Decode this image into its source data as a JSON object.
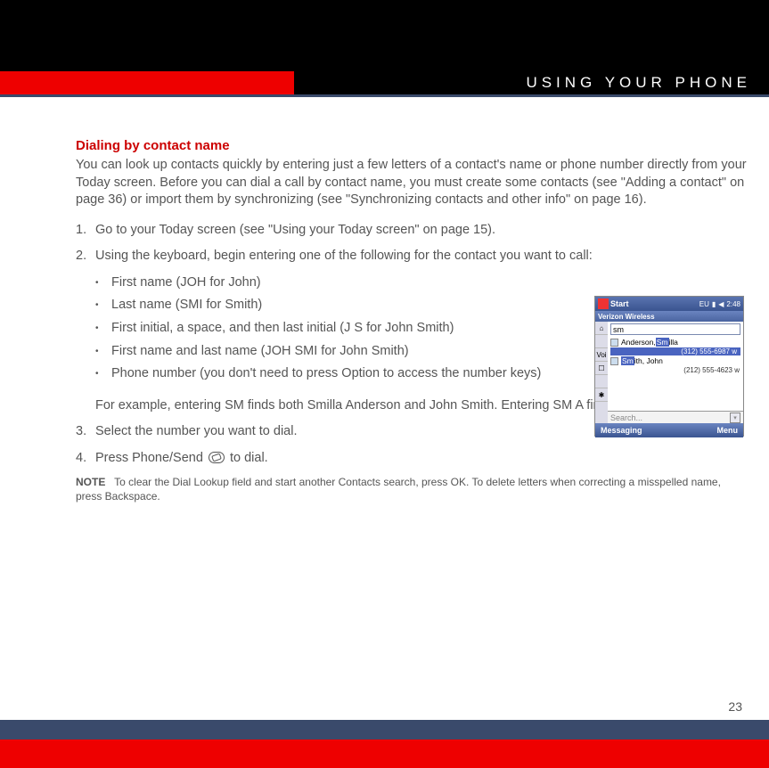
{
  "header": {
    "section_title": "USING YOUR PHONE"
  },
  "section": {
    "heading": "Dialing by contact name",
    "intro": "You can look up contacts quickly by entering just a few letters of a contact's name or phone number directly from your Today screen. Before you can dial a call by contact name, you must create some contacts (see \"Adding a contact\" on page 36) or import them by synchronizing (see \"Synchronizing contacts and other info\" on page 16).",
    "step1_num": "1.",
    "step1": "Go to your Today screen (see \"Using your Today screen\" on page 15).",
    "step2_num": "2.",
    "step2": "Using the keyboard, begin entering one of the following for the contact you want to call:",
    "bullets": [
      "First name (JOH for John)",
      "Last name (SMI for Smith)",
      "First initial, a space, and then last initial (J S for John Smith)",
      "First name and last name (JOH SMI for John Smith)",
      "Phone number (you don't need to press Option to access the number keys)"
    ],
    "followup": "For example, entering SM finds both Smilla Anderson and John Smith. Entering SM A finds only Smilla Anderson.",
    "step3_num": "3.",
    "step3": "Select the number you want to dial.",
    "step4_num": "4.",
    "step4_a": "Press Phone/Send ",
    "step4_b": " to dial.",
    "note_label": "NOTE",
    "note_body": "To clear the Dial Lookup field and start another Contacts search, press OK. To delete letters when correcting a misspelled name, press Backspace."
  },
  "screenshot": {
    "start": "Start",
    "status_eu": "EU",
    "time": "2:48",
    "carrier": "Verizon Wireless",
    "input": "sm",
    "entry1_pre": "Anderson, ",
    "entry1_hl": "Sm",
    "entry1_post": "illa",
    "entry1_num": "(312) 555-6987 w",
    "entry2_hl": "Sm",
    "entry2_post": "ith, John",
    "entry2_num": "(212) 555-4623 w",
    "rail_voice": "Voi",
    "search": "Search...",
    "soft_left": "Messaging",
    "soft_right": "Menu"
  },
  "page_number": "23"
}
